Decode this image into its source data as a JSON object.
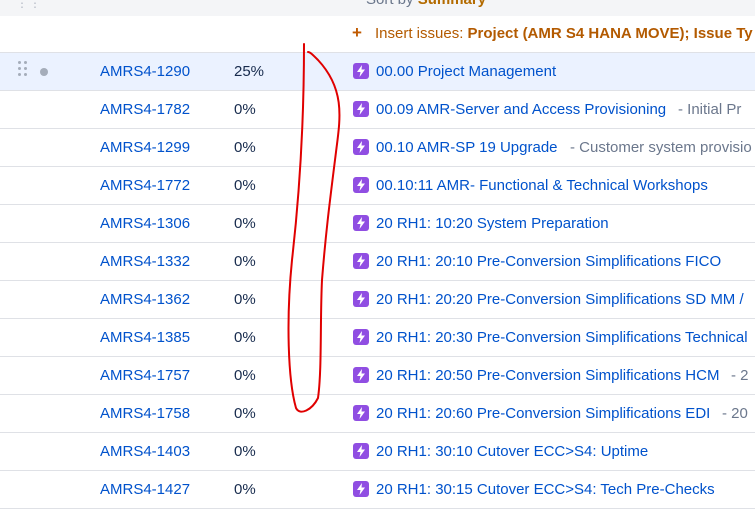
{
  "header": {
    "sort_label": "Sort by ",
    "sort_value": "Summary",
    "insert_label": "Insert issues: ",
    "insert_value": "Project (AMR S4 HANA MOVE); Issue Ty"
  },
  "rows": [
    {
      "key": "AMRS4-1290",
      "progress": "25%",
      "summary": "00.00 Project Management",
      "desc": ""
    },
    {
      "key": "AMRS4-1782",
      "progress": "0%",
      "summary": "00.09 AMR-Server and Access Provisioning",
      "desc": "-  Initial Pr"
    },
    {
      "key": "AMRS4-1299",
      "progress": "0%",
      "summary": "00.10 AMR-SP 19 Upgrade",
      "desc": "-  Customer system provisio"
    },
    {
      "key": "AMRS4-1772",
      "progress": "0%",
      "summary": "00.10:11 AMR- Functional & Technical Workshops",
      "desc": ""
    },
    {
      "key": "AMRS4-1306",
      "progress": "0%",
      "summary": "20 RH1: 10:20 System Preparation",
      "desc": ""
    },
    {
      "key": "AMRS4-1332",
      "progress": "0%",
      "summary": "20 RH1: 20:10 Pre-Conversion Simplifications FICO",
      "desc": ""
    },
    {
      "key": "AMRS4-1362",
      "progress": "0%",
      "summary": "20 RH1: 20:20 Pre-Conversion Simplifications SD MM /",
      "desc": ""
    },
    {
      "key": "AMRS4-1385",
      "progress": "0%",
      "summary": "20 RH1: 20:30 Pre-Conversion Simplifications Technical",
      "desc": ""
    },
    {
      "key": "AMRS4-1757",
      "progress": "0%",
      "summary": "20 RH1: 20:50 Pre-Conversion Simplifications HCM",
      "desc": "-  2"
    },
    {
      "key": "AMRS4-1758",
      "progress": "0%",
      "summary": "20 RH1: 20:60 Pre-Conversion Simplifications EDI",
      "desc": "-  20"
    },
    {
      "key": "AMRS4-1403",
      "progress": "0%",
      "summary": "20 RH1: 30:10 Cutover ECC>S4: Uptime",
      "desc": ""
    },
    {
      "key": "AMRS4-1427",
      "progress": "0%",
      "summary": "20 RH1: 30:15 Cutover ECC>S4: Tech Pre-Checks",
      "desc": ""
    }
  ],
  "colors": {
    "link": "#0052cc",
    "story_icon": "#904ee2",
    "selected_row": "#ebf2ff",
    "annotation_stroke": "#e00000"
  },
  "icons": {
    "type_icon": "lightning-bolt-icon",
    "drag_handle": "drag-handle-icon",
    "insert": "plus-icon"
  }
}
